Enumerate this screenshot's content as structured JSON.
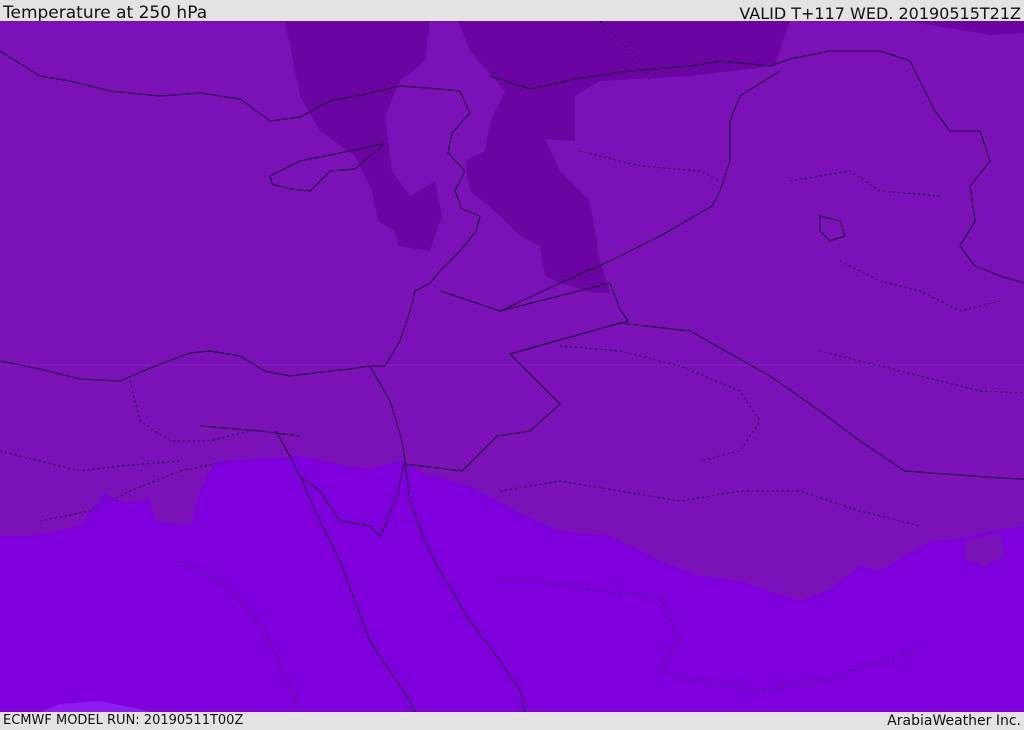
{
  "header": {
    "title": "Temperature at 250 hPa",
    "valid": "VALID T+117 WED. 20190515T21Z"
  },
  "footer": {
    "model_run": "ECMWF MODEL RUN: 20190511T00Z",
    "brand": "ArabiaWeather Inc."
  },
  "map": {
    "colors": {
      "warm_band": "#7a12b8",
      "cool_core": "#6a05a2",
      "southern_band": "#7f00dc",
      "far_south": "#8c1cf0"
    },
    "region": "Eastern Mediterranean and Middle East"
  }
}
